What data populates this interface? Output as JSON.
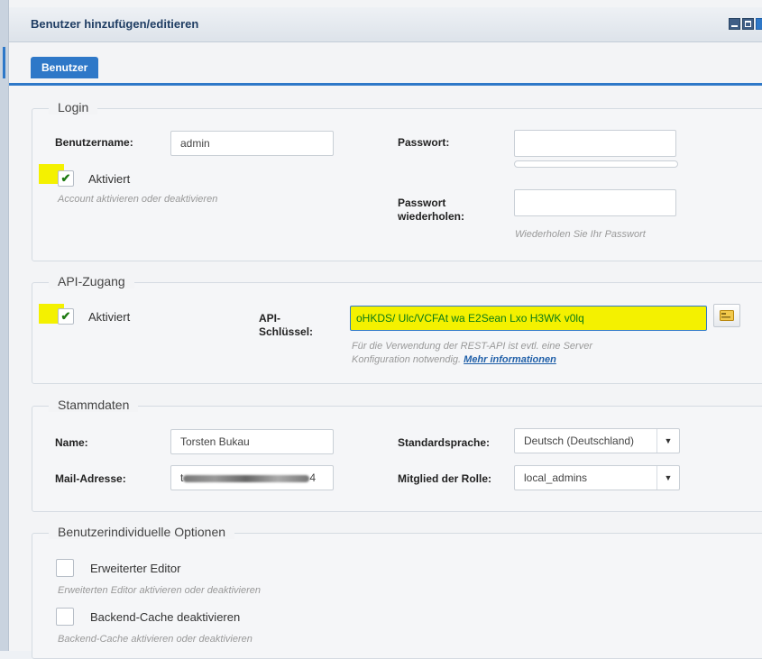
{
  "window": {
    "title": "Benutzer hinzufügen/editieren"
  },
  "tabs": [
    {
      "label": "Benutzer"
    }
  ],
  "login": {
    "legend": "Login",
    "username_label": "Benutzername:",
    "username_value": "admin",
    "password_label": "Passwort:",
    "password_value": "",
    "active_label": "Aktiviert",
    "active_checked": true,
    "active_hint": "Account aktivieren oder deaktivieren",
    "password_repeat_label_1": "Passwort",
    "password_repeat_label_2": "wiederholen:",
    "password_repeat_hint": "Wiederholen Sie Ihr Passwort"
  },
  "api": {
    "legend": "API-Zugang",
    "active_label": "Aktiviert",
    "active_checked": true,
    "key_label_1": "API-",
    "key_label_2": "Schlüssel:",
    "key_value": "oHKDS/ Ulc/VCFAt wa E2Sean Lxo H3WK v0lq",
    "hint_line1": "Für die Verwendung der REST-API ist evtl. eine Server",
    "hint_line2": "Konfiguration notwendig.",
    "more_link": "Mehr informationen"
  },
  "stammdaten": {
    "legend": "Stammdaten",
    "name_label": "Name:",
    "name_value": "Torsten Bukau",
    "mail_label": "Mail-Adresse:",
    "mail_value_prefix": "t",
    "mail_value_suffix": "4",
    "language_label": "Standardsprache:",
    "language_value": "Deutsch (Deutschland)",
    "role_label": "Mitglied der Rolle:",
    "role_value": "local_admins"
  },
  "options": {
    "legend": "Benutzerindividuelle Optionen",
    "editor_label": "Erweiterter Editor",
    "editor_hint": "Erweiterten Editor aktivieren oder deaktivieren",
    "cache_label": "Backend-Cache deaktivieren",
    "cache_hint": "Backend-Cache aktivieren oder deaktivieren"
  },
  "colors": {
    "accent": "#2e78c8",
    "highlight": "#f4f100",
    "check": "#1e7a12"
  }
}
